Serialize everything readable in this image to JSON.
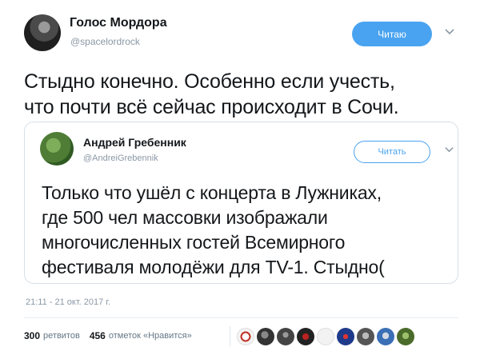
{
  "tweet": {
    "author_name": "Голос Мордора",
    "author_handle": "@spacelordrock",
    "follow_label": "Читаю",
    "text_line1": "Стыдно конечно. Особенно если учесть,",
    "text_line2": "что почти всё сейчас происходит в Сочи.",
    "timestamp": "21:11 - 21 окт. 2017 г.",
    "retweets_count": "300",
    "retweets_label": "ретвитов",
    "likes_count": "456",
    "likes_label": "отметок «Нравится»"
  },
  "quoted": {
    "author_name": "Андрей Гребенник",
    "author_handle": "@AndreiGrebennik",
    "follow_label": "Читать",
    "line1": "Только что ушёл с концерта в Лужниках,",
    "line2": "где 500 чел массовки изображали",
    "line3": "многочисленных гостей Всемирного",
    "line4": "фестиваля молодёжи для TV-1. Стыдно("
  },
  "icons": {
    "chevron": "chevron-down-icon"
  },
  "colors": {
    "accent": "#4aa3f0",
    "muted": "#8b98a5",
    "text": "#14171a"
  }
}
